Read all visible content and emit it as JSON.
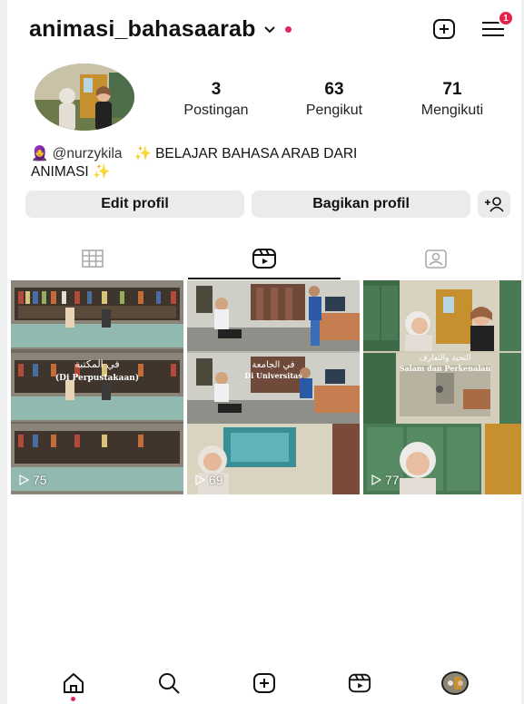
{
  "header": {
    "username": "animasi_bahasaarab",
    "notification_count": "1"
  },
  "profile": {
    "stats": [
      {
        "value": "3",
        "label": "Postingan"
      },
      {
        "value": "63",
        "label": "Pengikut"
      },
      {
        "value": "71",
        "label": "Mengikuti"
      }
    ],
    "bio_handle": "@nurzykila",
    "bio_text_1": "BELAJAR BAHASA ARAB DARI",
    "bio_text_2": "ANIMASI",
    "bio_emoji_person": "🧕",
    "bio_emoji_sparkle": "✨"
  },
  "buttons": {
    "edit": "Edit profil",
    "share": "Bagikan profil"
  },
  "posts": [
    {
      "caption_ar": "في المكتبة",
      "caption": "(Di Perpustakaan)",
      "views": "75"
    },
    {
      "caption_ar": "في الجامعة",
      "caption": "Di Universitas",
      "views": "69"
    },
    {
      "caption_ar": "التحية والتعارف",
      "caption": "Salam dan Perkenalan",
      "views": "77"
    }
  ],
  "colors": {
    "accent_red": "#e0245e",
    "button_bg": "#ebebeb"
  }
}
